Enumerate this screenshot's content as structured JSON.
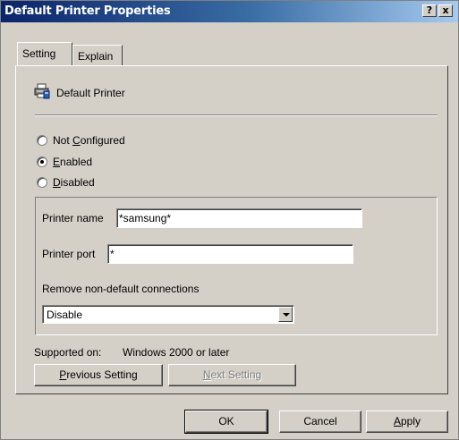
{
  "window": {
    "title": "Default Printer Properties",
    "help_label": "?",
    "close_label": "x"
  },
  "tabs": [
    {
      "label": "Setting",
      "active": true
    },
    {
      "label": "Explain",
      "active": false
    }
  ],
  "policy": {
    "name": "Default Printer",
    "icon": "printer-policy-icon"
  },
  "state_options": [
    {
      "label_pre": "Not ",
      "label_key": "C",
      "label_post": "onfigured",
      "selected": false
    },
    {
      "label_pre": "",
      "label_key": "E",
      "label_post": "nabled",
      "selected": true
    },
    {
      "label_pre": "",
      "label_key": "D",
      "label_post": "isabled",
      "selected": false
    }
  ],
  "options": {
    "printer_name_label": "Printer name",
    "printer_name_value": "*samsung*",
    "printer_port_label": "Printer port",
    "printer_port_value": "*",
    "remove_label": "Remove non-default connections",
    "remove_selected": "Disable"
  },
  "supported": {
    "label": "Supported on:",
    "value": "Windows 2000 or later"
  },
  "buttons": {
    "previous_key": "P",
    "previous_rest": "revious Setting",
    "next_key": "N",
    "next_rest": "ext Setting",
    "ok": "OK",
    "cancel": "Cancel",
    "apply_key": "A",
    "apply_rest": "pply"
  }
}
